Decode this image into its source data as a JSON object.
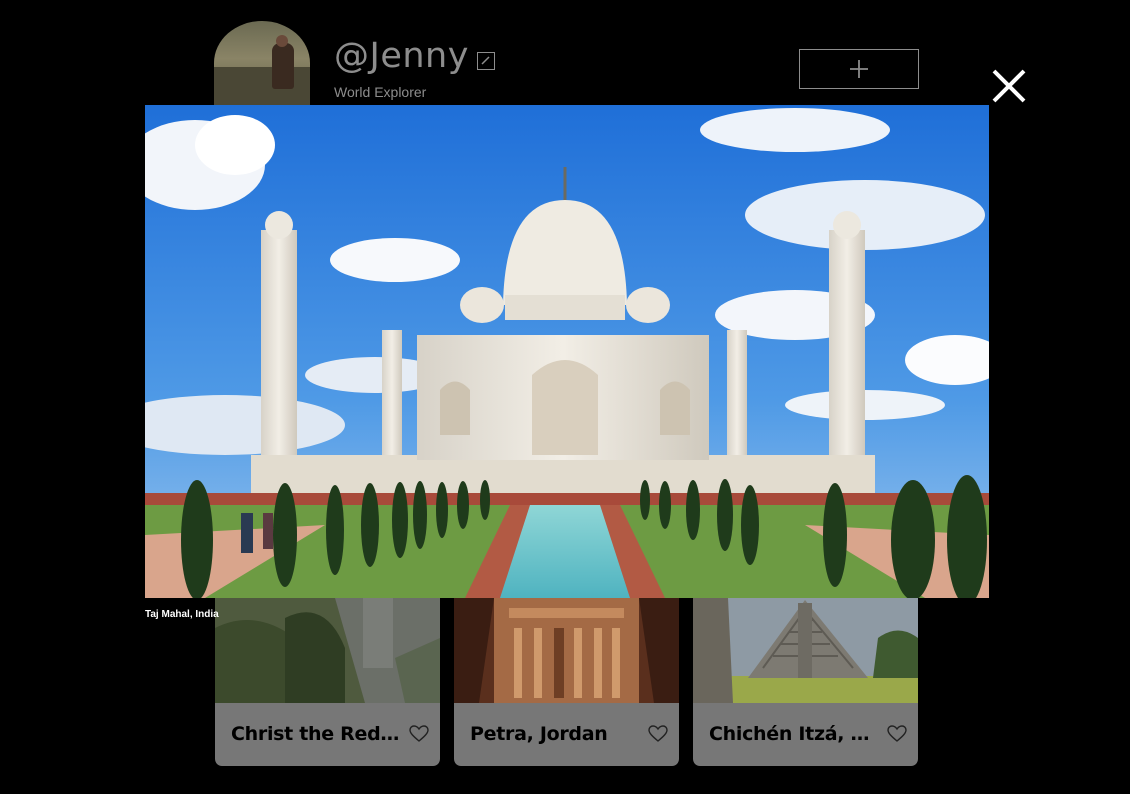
{
  "profile": {
    "username": "@Jenny",
    "subtitle": "World Explorer"
  },
  "icons": {
    "edit": "edit-icon",
    "add": "plus-icon",
    "close": "close-icon",
    "favorite": "heart-icon"
  },
  "modal": {
    "caption": "Taj Mahal, India"
  },
  "cards": [
    {
      "title": "Christ the Redeemer"
    },
    {
      "title": "Petra, Jordan"
    },
    {
      "title": "Chichén Itzá, Mexico"
    }
  ],
  "colors": {
    "background": "#000000",
    "muted_text": "#8d8d8d",
    "card_bg": "#777777"
  }
}
